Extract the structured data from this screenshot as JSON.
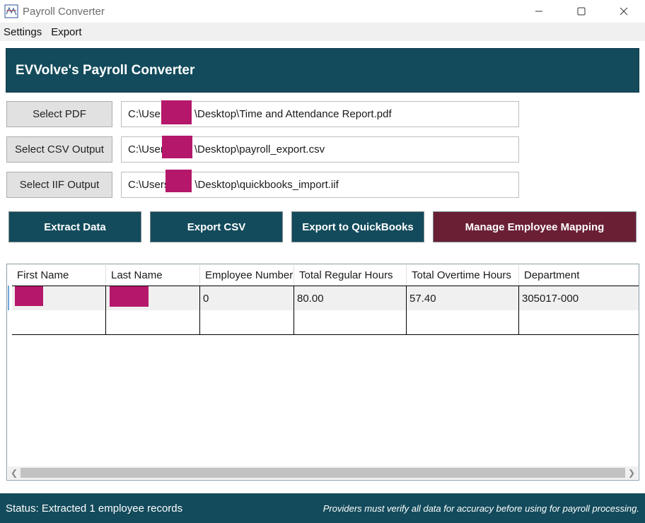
{
  "window": {
    "title": "Payroll Converter",
    "icons": {
      "app": "app-icon",
      "minimize": "minimize-icon",
      "maximize": "maximize-icon",
      "close": "close-icon"
    }
  },
  "menu": {
    "items": [
      "Settings",
      "Export"
    ]
  },
  "header": {
    "title": "EVVolve's Payroll Converter"
  },
  "files": {
    "pdf": {
      "button": "Select PDF",
      "prefix": "C:\\User",
      "suffix": "\\Desktop\\Time and Attendance Report.pdf"
    },
    "csv": {
      "button": "Select CSV Output",
      "prefix": "C:\\User",
      "suffix": "\\Desktop\\payroll_export.csv"
    },
    "iif": {
      "button": "Select IIF Output",
      "prefix": "C:\\Users",
      "suffix": "\\Desktop\\quickbooks_import.iif"
    }
  },
  "actions": {
    "extract": "Extract Data",
    "export_csv": "Export CSV",
    "export_qb": "Export to QuickBooks",
    "manage_mapping": "Manage Employee Mapping"
  },
  "grid": {
    "columns": [
      "First Name",
      "Last Name",
      "Employee Number",
      "Total Regular Hours",
      "Total Overtime Hours",
      "Department"
    ],
    "rows": [
      {
        "first_name": "",
        "last_name": "",
        "employee_number": "0",
        "regular_hours": "80.00",
        "overtime_hours": "57.40",
        "department": "305017-000"
      }
    ]
  },
  "status": {
    "text": "Status: Extracted 1 employee records",
    "disclaimer": "Providers must verify all data for accuracy before using for payroll processing."
  },
  "colors": {
    "accent": "#134b5c",
    "maroon": "#6a1f35",
    "redaction": "#b5176a"
  }
}
